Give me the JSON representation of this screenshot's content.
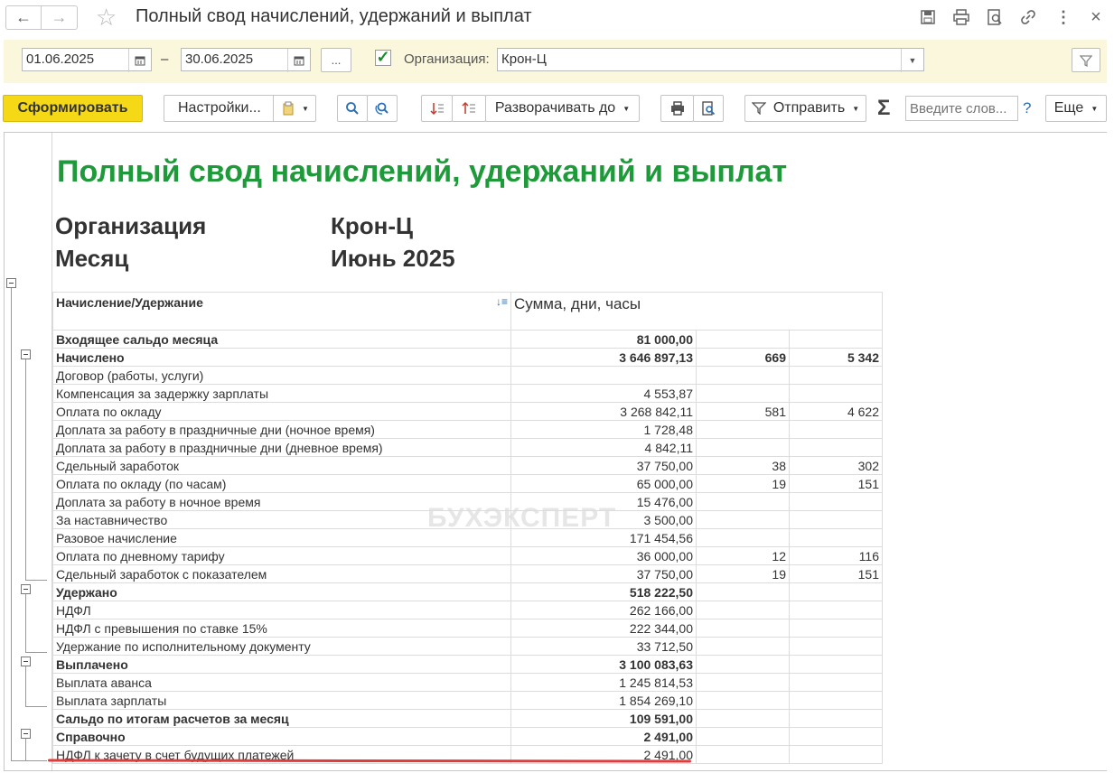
{
  "window": {
    "title": "Полный свод начислений, удержаний и выплат"
  },
  "filters": {
    "date_from": "01.06.2025",
    "dash": "–",
    "date_to": "30.06.2025",
    "more_label": "...",
    "org_checked": true,
    "org_label": "Организация:",
    "org_value": "Крон-Ц"
  },
  "toolbar": {
    "generate": "Сформировать",
    "settings": "Настройки...",
    "expand_to": "Разворачивать до",
    "send": "Отправить",
    "sum_symbol": "Σ",
    "search_placeholder": "Введите слов...",
    "help": "?",
    "more": "Еще"
  },
  "report": {
    "title": "Полный свод начислений, удержаний и выплат",
    "org_key": "Организация",
    "org_val": "Крон-Ц",
    "month_key": "Месяц",
    "month_val": "Июнь 2025",
    "col_header": "Начисление/Удержание",
    "col_sum_header": "Сумма, дни, часы",
    "watermark": "БУХЭКСПЕРТ",
    "rows": [
      {
        "label": "Входящее сальдо месяца",
        "sum": "81 000,00",
        "days": "",
        "hours": "",
        "bold": true
      },
      {
        "label": "Начислено",
        "sum": "3 646 897,13",
        "days": "669",
        "hours": "5 342",
        "bold": true
      },
      {
        "label": "Договор (работы, услуги)",
        "sum": "",
        "days": "",
        "hours": "",
        "bold": false
      },
      {
        "label": "Компенсация за задержку зарплаты",
        "sum": "4 553,87",
        "days": "",
        "hours": "",
        "bold": false
      },
      {
        "label": "Оплата по окладу",
        "sum": "3 268 842,11",
        "days": "581",
        "hours": "4 622",
        "bold": false
      },
      {
        "label": "Доплата за работу в праздничные дни (ночное время)",
        "sum": "1 728,48",
        "days": "",
        "hours": "",
        "bold": false
      },
      {
        "label": "Доплата за работу в праздничные дни (дневное время)",
        "sum": "4 842,11",
        "days": "",
        "hours": "",
        "bold": false
      },
      {
        "label": "Сдельный заработок",
        "sum": "37 750,00",
        "days": "38",
        "hours": "302",
        "bold": false
      },
      {
        "label": "Оплата по окладу (по часам)",
        "sum": "65 000,00",
        "days": "19",
        "hours": "151",
        "bold": false
      },
      {
        "label": "Доплата за работу в ночное время",
        "sum": "15 476,00",
        "days": "",
        "hours": "",
        "bold": false
      },
      {
        "label": "За наставничество",
        "sum": "3 500,00",
        "days": "",
        "hours": "",
        "bold": false
      },
      {
        "label": "Разовое начисление",
        "sum": "171 454,56",
        "days": "",
        "hours": "",
        "bold": false
      },
      {
        "label": "Оплата по дневному тарифу",
        "sum": "36 000,00",
        "days": "12",
        "hours": "116",
        "bold": false
      },
      {
        "label": "Сдельный заработок с показателем",
        "sum": "37 750,00",
        "days": "19",
        "hours": "151",
        "bold": false
      },
      {
        "label": "Удержано",
        "sum": "518 222,50",
        "days": "",
        "hours": "",
        "bold": true
      },
      {
        "label": "НДФЛ",
        "sum": "262 166,00",
        "days": "",
        "hours": "",
        "bold": false
      },
      {
        "label": "НДФЛ с превышения по ставке 15%",
        "sum": "222 344,00",
        "days": "",
        "hours": "",
        "bold": false
      },
      {
        "label": "Удержание по исполнительному документу",
        "sum": "33 712,50",
        "days": "",
        "hours": "",
        "bold": false
      },
      {
        "label": "Выплачено",
        "sum": "3 100 083,63",
        "days": "",
        "hours": "",
        "bold": true
      },
      {
        "label": "Выплата аванса",
        "sum": "1 245 814,53",
        "days": "",
        "hours": "",
        "bold": false
      },
      {
        "label": "Выплата зарплаты",
        "sum": "1 854 269,10",
        "days": "",
        "hours": "",
        "bold": false
      },
      {
        "label": "Сальдо по итогам расчетов за месяц",
        "sum": "109 591,00",
        "days": "",
        "hours": "",
        "bold": true
      },
      {
        "label": "Справочно",
        "sum": "2 491,00",
        "days": "",
        "hours": "",
        "bold": true
      },
      {
        "label": "НДФЛ к зачету в счет будущих платежей",
        "sum": "2 491,00",
        "days": "",
        "hours": "",
        "bold": false
      }
    ]
  }
}
